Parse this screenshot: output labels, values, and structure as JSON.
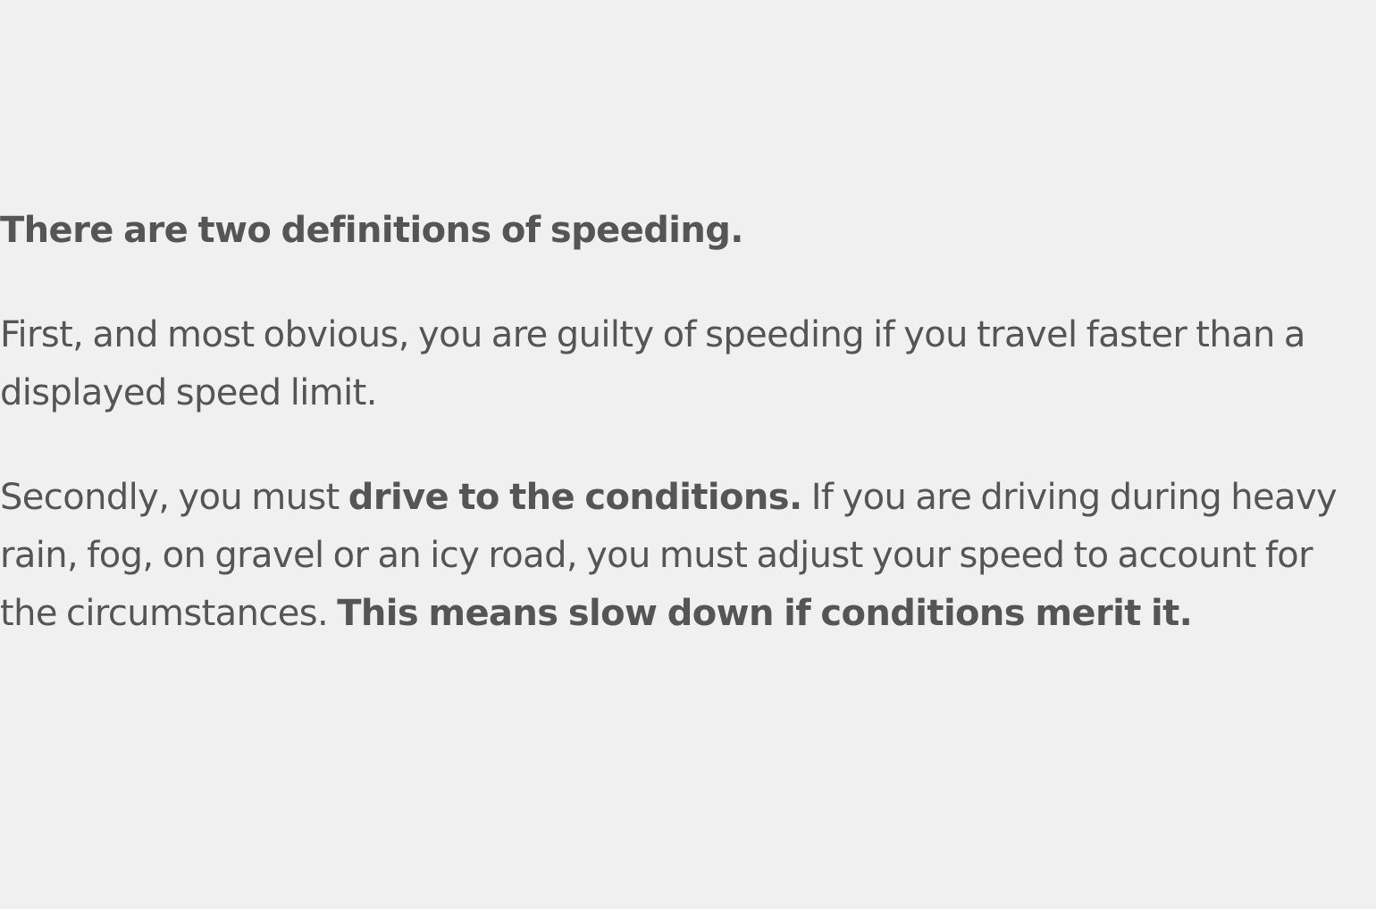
{
  "article": {
    "heading": "There are two definitions of speeding.",
    "paragraph1": "First, and most obvious, you are guilty of speeding if you travel faster than a displayed speed limit.",
    "paragraph2": {
      "part1": "Secondly, you must ",
      "bold1": "drive to the conditions.",
      "part2": " If you are driving during heavy rain, fog, on gravel or an icy road, you must adjust your speed to account for the circumstances. ",
      "bold2": "This means slow down if conditions merit it."
    }
  },
  "colors": {
    "background": "#f0f0f0",
    "text": "#555555"
  }
}
